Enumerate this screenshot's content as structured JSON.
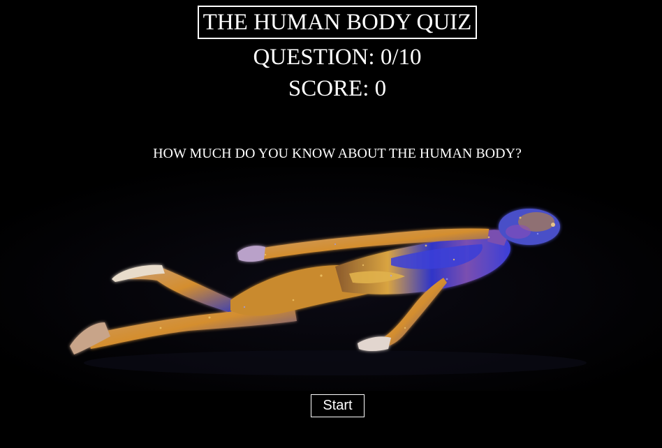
{
  "header": {
    "title": "THE HUMAN BODY QUIZ",
    "question_counter": "QUESTION: 0/10",
    "score": "SCORE: 0"
  },
  "intro": {
    "question": "HOW MUCH DO YOU KNOW ABOUT THE HUMAN BODY?"
  },
  "hero_image": {
    "icon": "floating-human-body-image",
    "colors": {
      "blue": "#3b3fd8",
      "gold": "#d9a441",
      "purple": "#8a4fb8",
      "background": "#000000"
    }
  },
  "actions": {
    "start_label": "Start"
  }
}
